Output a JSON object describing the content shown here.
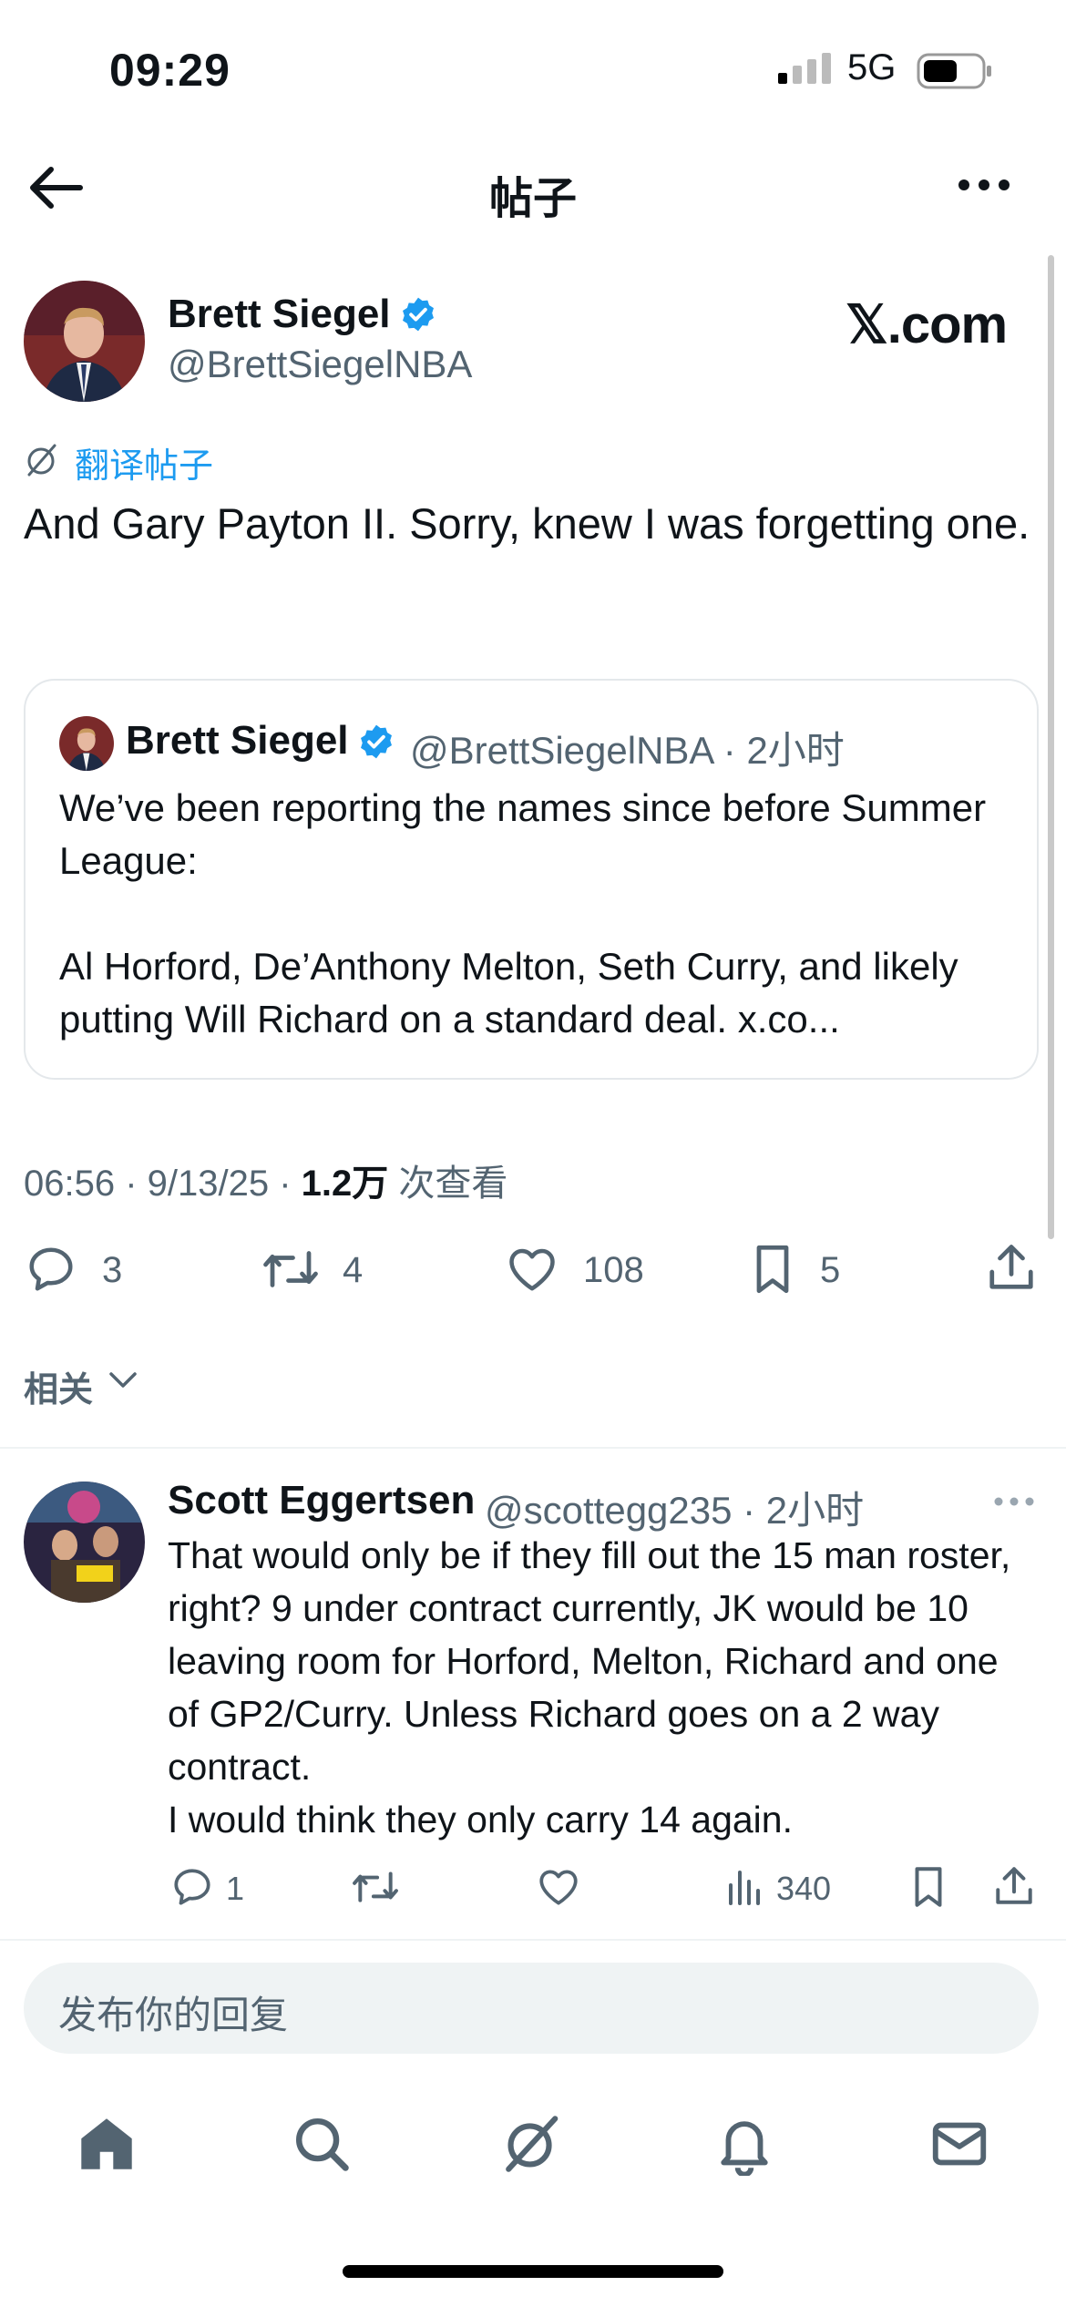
{
  "status_bar": {
    "time": "09:29",
    "network": "5G"
  },
  "header": {
    "title": "帖子"
  },
  "tweet": {
    "author_name": "Brett Siegel",
    "author_handle": "@BrettSiegelNBA",
    "source_logo": "𝕏.com",
    "translate_label": "翻译帖子",
    "text": "And Gary Payton II. Sorry, knew I was forgetting one.",
    "meta_time": "06:56 · 9/13/25 · ",
    "meta_views": "1.2万",
    "meta_views_suffix": " 次查看",
    "actions": {
      "replies": "3",
      "reposts": "4",
      "likes": "108",
      "bookmarks": "5"
    },
    "quote": {
      "author_name": "Brett Siegel",
      "meta": "@BrettSiegelNBA · 2小时",
      "text": "We’ve been reporting the names since before Summer League:\n\nAl Horford, De’Anthony Melton, Seth Curry, and likely putting Will Richard on a standard deal. x.co..."
    }
  },
  "related": {
    "label": "相关"
  },
  "reply": {
    "author_name": "Scott Eggertsen",
    "meta": "@scottegg235 · 2小时",
    "text": "That would only be if they fill out the 15 man roster, right? 9 under contract currently, JK would be 10 leaving room for Horford, Melton, Richard and one of GP2/Curry. Unless Richard goes on a 2 way contract.\nI would think they only carry 14 again.",
    "actions": {
      "replies": "1",
      "views": "340"
    }
  },
  "composer": {
    "placeholder": "发布你的回复"
  },
  "tabs": [
    {
      "icon": "home-icon"
    },
    {
      "icon": "search-icon"
    },
    {
      "icon": "grok-icon"
    },
    {
      "icon": "bell-icon"
    },
    {
      "icon": "mail-icon"
    }
  ],
  "colors": {
    "accent": "#1d9bf0",
    "secondary_text": "#536471",
    "text": "#0f1419"
  }
}
